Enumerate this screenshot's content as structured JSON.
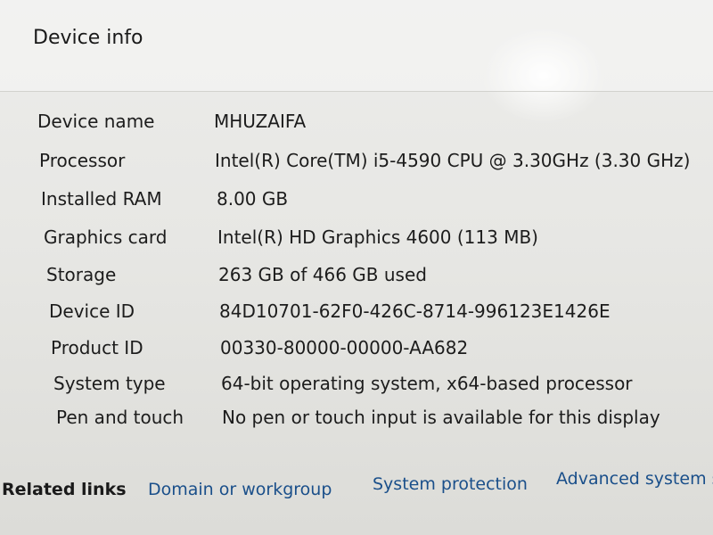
{
  "section": {
    "title": "Device info"
  },
  "specs": [
    {
      "label": "Device name",
      "value": "MHUZAIFA"
    },
    {
      "label": "Processor",
      "value": "Intel(R) Core(TM) i5-4590 CPU @ 3.30GHz (3.30 GHz)"
    },
    {
      "label": "Installed RAM",
      "value": "8.00 GB"
    },
    {
      "label": "Graphics card",
      "value": "Intel(R) HD Graphics 4600 (113 MB)"
    },
    {
      "label": "Storage",
      "value": "263 GB of 466 GB used"
    },
    {
      "label": "Device ID",
      "value": "84D10701-62F0-426C-8714-996123E1426E"
    },
    {
      "label": "Product ID",
      "value": "00330-80000-00000-AA682"
    },
    {
      "label": "System type",
      "value": "64-bit operating system, x64-based processor"
    },
    {
      "label": "Pen and touch",
      "value": "No pen or touch input is available for this display"
    }
  ],
  "related_links": {
    "label": "Related links",
    "links": [
      "Domain or workgroup",
      "System protection",
      "Advanced system se"
    ]
  },
  "colors": {
    "link": "#1a4f8a",
    "text": "#1c1c1c"
  }
}
